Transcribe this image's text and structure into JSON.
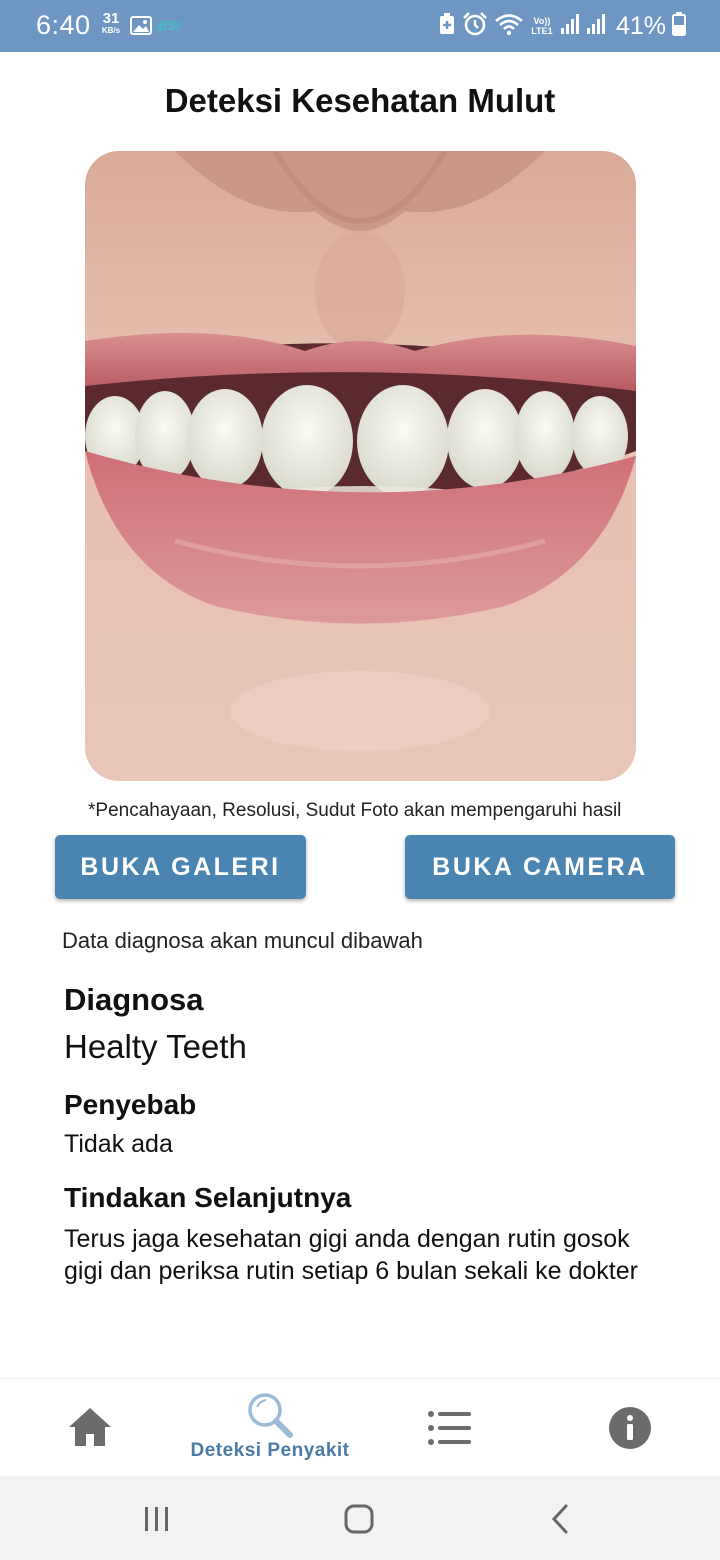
{
  "status_bar": {
    "time": "6:40",
    "net_speed_value": "31",
    "net_speed_unit": "KB/s",
    "carrier_badge": "BSI",
    "volte_label": "Vo)) LTE1",
    "battery_percent": "41%",
    "icons": [
      "gallery-icon",
      "accessibility-icon",
      "alarm-icon",
      "wifi-icon",
      "signal-icon",
      "signal-icon",
      "battery-icon"
    ],
    "background_color": "#6d97c2"
  },
  "page": {
    "title": "Deteksi Kesehatan Mulut",
    "photo_subject": "mouth-photo",
    "hint": "*Pencahayaan, Resolusi, Sudut Foto akan mempengaruhi hasil"
  },
  "actions": {
    "gallery_label": "BUKA GALERI",
    "camera_label": "BUKA CAMERA",
    "button_color": "#4a84b0"
  },
  "result": {
    "note": "Data diagnosa akan muncul dibawah",
    "diagnosis_heading": "Diagnosa",
    "diagnosis_value": "Healty Teeth",
    "cause_heading": "Penyebab",
    "cause_value": "Tidak ada",
    "action_heading": "Tindakan Selanjutnya",
    "action_value": "Terus jaga kesehatan gigi anda dengan rutin gosok gigi dan periksa rutin setiap 6 bulan sekali ke dokter"
  },
  "bottom_nav": {
    "items": [
      {
        "icon": "home-icon",
        "label": "",
        "active": false
      },
      {
        "icon": "search-icon",
        "label": "Deteksi Penyakit",
        "active": true
      },
      {
        "icon": "list-icon",
        "label": "",
        "active": false
      },
      {
        "icon": "info-icon",
        "label": "",
        "active": false
      }
    ],
    "active_color": "#4a7ba6",
    "inactive_color": "#6b6b6b"
  },
  "system_nav": {
    "buttons": [
      "recents-icon",
      "home-circle-icon",
      "back-icon"
    ]
  }
}
